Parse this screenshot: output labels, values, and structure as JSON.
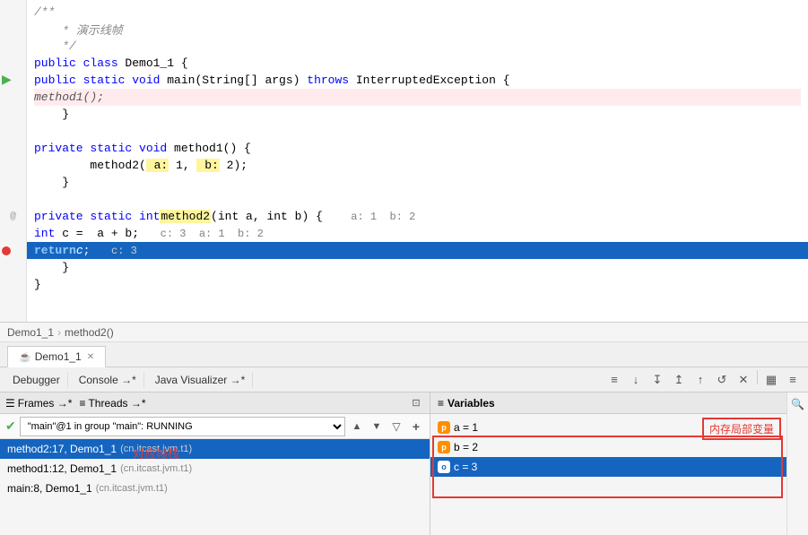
{
  "editor": {
    "lines": [
      {
        "num": "",
        "indent": 0,
        "content": "/**",
        "type": "comment",
        "gutter": ""
      },
      {
        "num": "",
        "indent": 1,
        "content": "* 演示线帧",
        "type": "comment",
        "gutter": ""
      },
      {
        "num": "",
        "indent": 1,
        "content": "*/",
        "type": "comment",
        "gutter": ""
      },
      {
        "num": "",
        "indent": 0,
        "content": "public class Demo1_1 {",
        "type": "code",
        "gutter": ""
      },
      {
        "num": "",
        "indent": 1,
        "content": "public static void main(String[] args) throws InterruptedException {",
        "type": "code",
        "gutter": "arrow"
      },
      {
        "num": "",
        "indent": 2,
        "content": "method1();",
        "type": "code-red",
        "gutter": ""
      },
      {
        "num": "",
        "indent": 1,
        "content": "}",
        "type": "code",
        "gutter": ""
      },
      {
        "num": "",
        "indent": 0,
        "content": "",
        "type": "code",
        "gutter": ""
      },
      {
        "num": "",
        "indent": 1,
        "content": "private static void method1() {",
        "type": "code",
        "gutter": ""
      },
      {
        "num": "",
        "indent": 2,
        "content": "method2( a: 1,  b: 2);",
        "type": "code",
        "gutter": ""
      },
      {
        "num": "",
        "indent": 1,
        "content": "}",
        "type": "code",
        "gutter": ""
      },
      {
        "num": "",
        "indent": 0,
        "content": "",
        "type": "code",
        "gutter": ""
      },
      {
        "num": "",
        "indent": 1,
        "content": "private static int method2(int a, int b) {   a: 1  b: 2",
        "type": "code",
        "gutter": "at"
      },
      {
        "num": "",
        "indent": 2,
        "content": "int c =  a + b;  c: 3  a: 1  b: 2",
        "type": "code",
        "gutter": ""
      },
      {
        "num": "",
        "indent": 2,
        "content": "return c;  c: 3",
        "type": "code-blue",
        "gutter": "dot"
      },
      {
        "num": "",
        "indent": 1,
        "content": "}",
        "type": "code",
        "gutter": ""
      },
      {
        "num": "",
        "indent": 0,
        "content": "}",
        "type": "code",
        "gutter": ""
      }
    ]
  },
  "breadcrumb": {
    "parts": [
      "Demo1_1",
      "method2()"
    ]
  },
  "tabs": {
    "items": [
      {
        "label": "Demo1_1",
        "active": true,
        "icon": "java"
      }
    ]
  },
  "toolbar": {
    "tabs": [
      "Debugger",
      "Console →*",
      "Java Visualizer →*"
    ],
    "buttons": [
      "≡",
      "↓",
      "↧",
      "↥",
      "↑",
      "↺",
      "✕",
      "▦",
      "≡≡"
    ]
  },
  "frames_panel": {
    "header_tabs": [
      "Frames →*",
      "Threads →*"
    ],
    "thread_label": "\"main\"@1 in group \"main\": RUNNING",
    "frames": [
      {
        "method": "method2:17, Demo1_1",
        "file": "(cn.itcast.jvm.t1)",
        "selected": true
      },
      {
        "method": "method1:12, Demo1_1",
        "file": "(cn.itcast.jvm.t1)",
        "selected": false
      },
      {
        "method": "main:8, Demo1_1",
        "file": "(cn.itcast.jvm.t1)",
        "selected": false
      }
    ]
  },
  "variables_panel": {
    "header": "Variables",
    "items": [
      {
        "badge": "p",
        "name": "a = 1",
        "selected": false
      },
      {
        "badge": "p",
        "name": "b = 2",
        "selected": false
      },
      {
        "badge": "o",
        "name": "c = 3",
        "selected": true
      }
    ]
  },
  "annotations": {
    "memory": "内存局部变量",
    "stack": "对应帧栈"
  }
}
